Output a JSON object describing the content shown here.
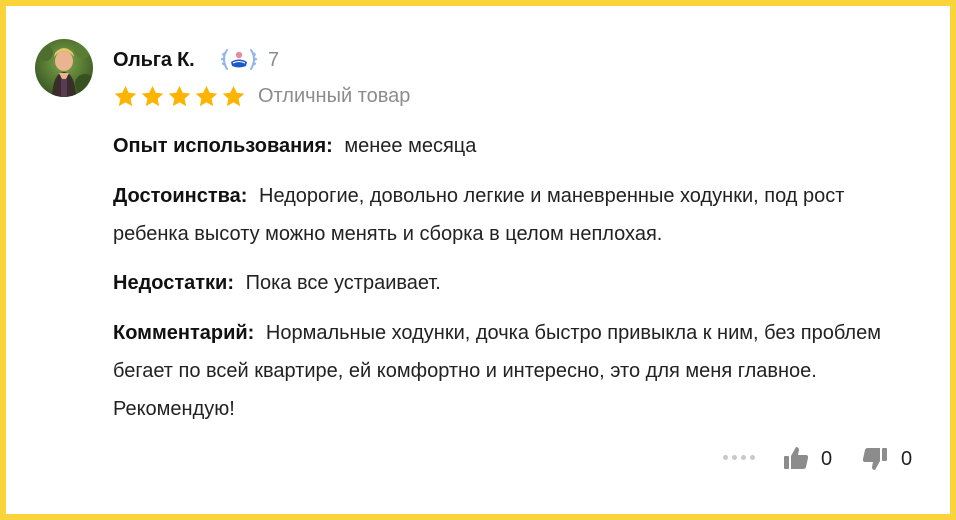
{
  "review": {
    "author": "Ольга К.",
    "badge_count": "7",
    "rating": 5,
    "rating_max": 5,
    "rating_text": "Отличный товар",
    "experience": {
      "label": "Опыт использования:",
      "value": "менее месяца"
    },
    "pros": {
      "label": "Достоинства:",
      "value": "Недорогие, довольно легкие и маневренные ходунки, под рост ребенка высоту можно менять и сборка в целом неплохая."
    },
    "cons": {
      "label": "Недостатки:",
      "value": "Пока все устраивает."
    },
    "comment": {
      "label": "Комментарий:",
      "value": "Нормальные ходунки, дочка быстро привыкла к ним, без проблем бегает по всей квартире, ей комфортно и интересно, это для меня главное. Рекомендую!"
    },
    "likes": "0",
    "dislikes": "0"
  },
  "colors": {
    "frame": "#fad43a",
    "star": "#fbb400",
    "muted": "#8c8c8c",
    "icon": "#8c8c8c"
  },
  "icons": [
    "avatar-photo",
    "laurel-badge-icon",
    "star-icon",
    "more-dots-icon",
    "thumbs-up-icon",
    "thumbs-down-icon"
  ]
}
